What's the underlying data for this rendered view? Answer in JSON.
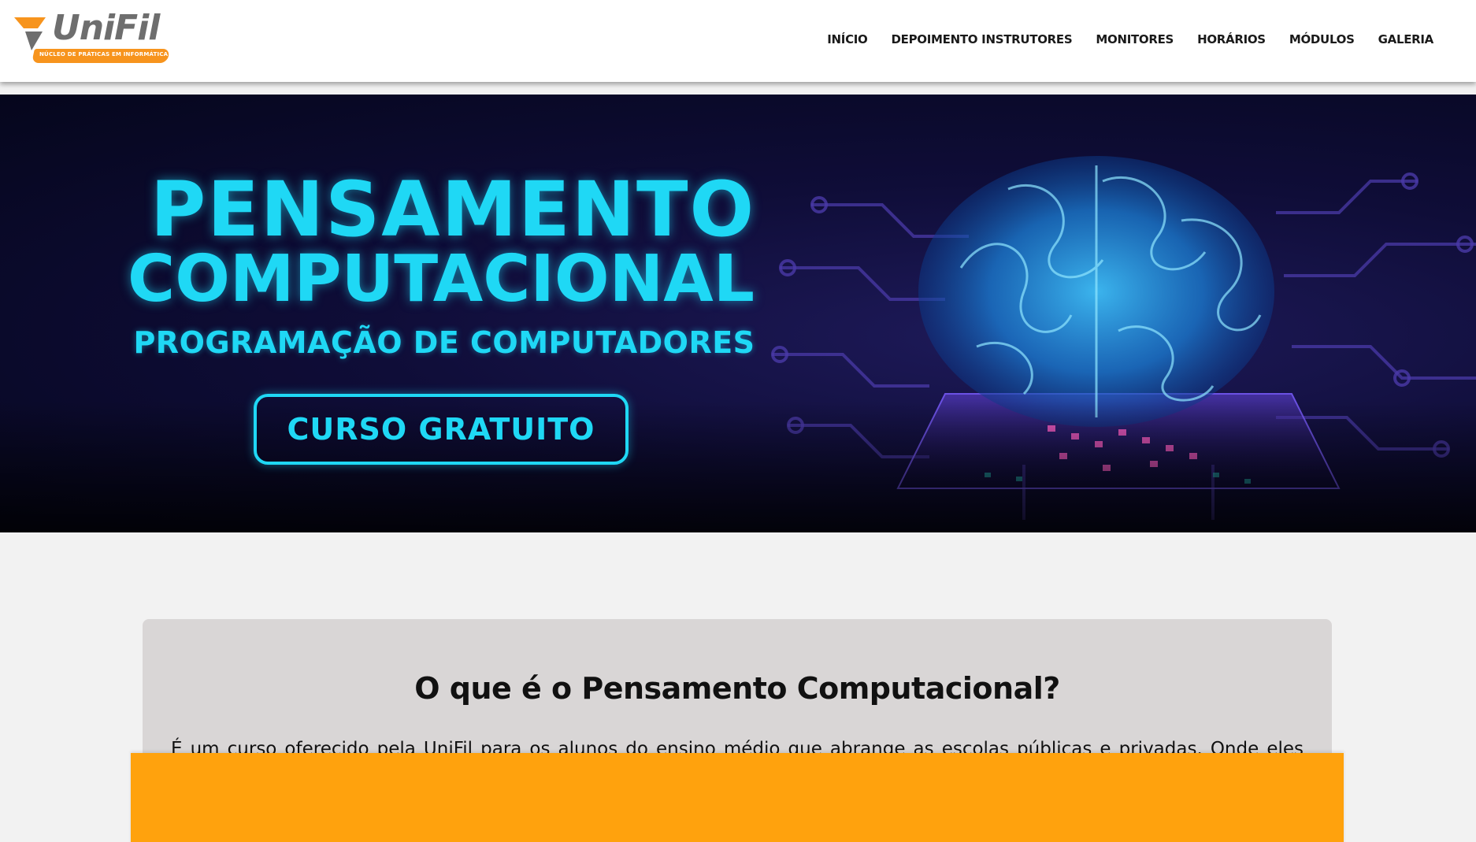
{
  "logo": {
    "name": "UniFil",
    "tagline": "NÚCLEO DE PRÁTICAS EM INFORMÁTICA"
  },
  "nav": {
    "items": [
      {
        "label": "INÍCIO"
      },
      {
        "label": "DEPOIMENTO INSTRUTORES"
      },
      {
        "label": "MONITORES"
      },
      {
        "label": "HORÁRIOS"
      },
      {
        "label": "MÓDULOS"
      },
      {
        "label": "GALERIA"
      }
    ]
  },
  "hero": {
    "title_line1": "PENSAMENTO",
    "title_line2": "COMPUTACIONAL",
    "subtitle": "PROGRAMAÇÃO DE COMPUTADORES",
    "cta": "CURSO GRATUITO"
  },
  "about": {
    "title": "O que é o Pensamento Computacional?",
    "text": "É um curso oferecido pela UniFil para os alunos do ensino médio que abrange as escolas públicas e privadas. Onde eles aprendem sobre o mundo da programação. Tem como objetivo Oferecer suporte à comunidade de Londrina e região, na área de desenvolvimento do pensamento lógico dos estudantes. O Curso pensamento Computacional da UNIFIL é uma oportunidade única para alunos do ensino médio das escolas públicas de Londrina. Totalmente gratuito, o curso oferece um"
  },
  "colors": {
    "accent_orange": "#f7941d",
    "banner_orange": "#ffa20d",
    "hero_cyan": "#1fd8f5",
    "card_gray": "#d9d6d6"
  }
}
